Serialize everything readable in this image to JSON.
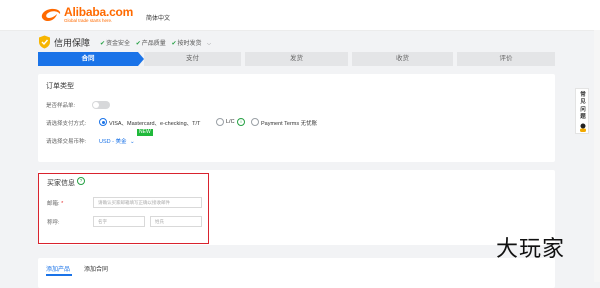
{
  "header": {
    "logo_text": "Alibaba.com",
    "logo_sub": "Global trade starts here.",
    "language": "简体中文"
  },
  "assurance": {
    "title": "信用保障",
    "guarantees": [
      "资金安全",
      "产品质量",
      "按时发货"
    ]
  },
  "steps": [
    {
      "label": "合同",
      "active": true
    },
    {
      "label": "支付",
      "active": false
    },
    {
      "label": "发货",
      "active": false
    },
    {
      "label": "收货",
      "active": false
    },
    {
      "label": "评价",
      "active": false
    }
  ],
  "order_type": {
    "title": "订单类型",
    "sample_label": "是否样品单:",
    "payment_label": "请选择支付方式:",
    "payment_options": [
      "VISA、Mastercard、e-checking、T/T",
      "L/C",
      "Payment Terms 无忧账"
    ],
    "currency_label": "请选择交易币种:",
    "currency_value": "USD - 美金",
    "new_badge": "NEW",
    "lc_info": "i"
  },
  "buyer_info": {
    "title": "买家信息",
    "email_label": "邮箱:",
    "required_mark": "*",
    "email_placeholder": "请确认买家邮箱填写正确以接收邮件",
    "name_label": "称呼:",
    "first_name_placeholder": "名字",
    "last_name_placeholder": "姓氏",
    "info_icon": "?"
  },
  "products": {
    "tabs": [
      "添加产品",
      "添加合同"
    ]
  },
  "side_widget": {
    "label_line1": "常见",
    "label_line2": "问题"
  },
  "watermark": "大玩家",
  "colors": {
    "brand_orange": "#ff6a00",
    "active_blue": "#1a73e8",
    "success_green": "#27a145",
    "highlight_red": "#d9232e"
  }
}
